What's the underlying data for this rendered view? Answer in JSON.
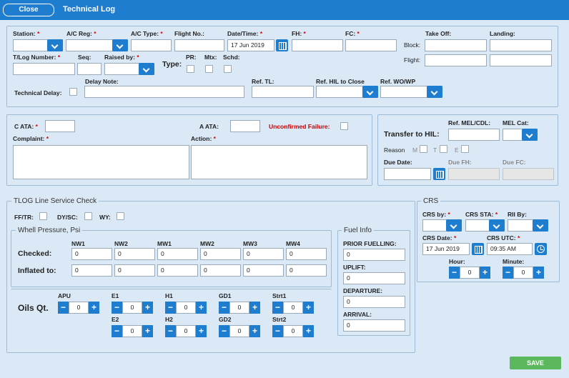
{
  "header": {
    "close_label": "Close",
    "title": "Technical Log"
  },
  "general": {
    "station_label": "Station:",
    "ac_reg_label": "A/C Reg:",
    "ac_type_label": "A/C Type:",
    "flight_no_label": "Flight No.:",
    "datetime_label": "Date/Time:",
    "datetime_value": "17 Jun 2019",
    "fh_label": "FH:",
    "fc_label": "FC:",
    "takeoff_label": "Take Off:",
    "landing_label": "Landing:",
    "block_label": "Block:",
    "flight_label": "Flight:",
    "tlog_number_label": "T/Log Number:",
    "seq_label": "Seq:",
    "raised_by_label": "Raised by:",
    "type_label": "Type:",
    "pr_label": "PR:",
    "mtx_label": "Mtx:",
    "schd_label": "Schd:",
    "technical_delay_label": "Technical Delay:",
    "delay_note_label": "Delay Note:",
    "ref_tl_label": "Ref. TL:",
    "ref_hil_label": "Ref. HIL to Close",
    "ref_wo_label": "Ref. WO/WP",
    "required_mark": "*"
  },
  "complaint": {
    "c_ata_label": "C ATA:",
    "a_ata_label": "A ATA:",
    "unconfirmed_label": "Unconfirmed Failure:",
    "complaint_label": "Complaint:",
    "action_label": "Action:"
  },
  "hil": {
    "ref_mel_label": "Ref. MEL/CDL:",
    "mel_cat_label": "MEL Cat:",
    "transfer_label": "Transfer to HIL:",
    "reason_label": "Reason",
    "reason_m": "M",
    "reason_t": "T",
    "reason_e": "E",
    "due_date_label": "Due Date:",
    "due_fh_label": "Due FH:",
    "due_fc_label": "Due FC:"
  },
  "line_check": {
    "legend": "TLOG Line Service Check",
    "fftr_label": "FF/TR:",
    "dysc_label": "DY/SC:",
    "wy_label": "WY:",
    "wheel_legend": "Whell Pressure, Psi",
    "wheel_columns": [
      "NW1",
      "NW2",
      "MW1",
      "MW2",
      "MW3",
      "MW4"
    ],
    "checked_label": "Checked:",
    "checked_values": [
      "0",
      "0",
      "0",
      "0",
      "0",
      "0"
    ],
    "inflated_label": "Inflated to:",
    "inflated_values": [
      "0",
      "0",
      "0",
      "0",
      "0",
      "0"
    ],
    "oils_label": "Oils Qt.",
    "oils_row1": [
      {
        "label": "APU",
        "value": "0"
      },
      {
        "label": "E1",
        "value": "0"
      },
      {
        "label": "H1",
        "value": "0"
      },
      {
        "label": "GD1",
        "value": "0"
      },
      {
        "label": "Strt1",
        "value": "0"
      }
    ],
    "oils_row2": [
      {
        "label": "E2",
        "value": "0"
      },
      {
        "label": "H2",
        "value": "0"
      },
      {
        "label": "GD2",
        "value": "0"
      },
      {
        "label": "Strt2",
        "value": "0"
      }
    ],
    "minus": "−",
    "plus": "+"
  },
  "fuel": {
    "legend": "Fuel Info",
    "prior_label": "PRIOR FUELLING:",
    "prior_value": "0",
    "uplift_label": "UPLIFT:",
    "uplift_value": "0",
    "departure_label": "DEPARTURE:",
    "departure_value": "0",
    "arrival_label": "ARRIVAL:",
    "arrival_value": "0"
  },
  "crs": {
    "legend": "CRS",
    "crs_by_label": "CRS by:",
    "crs_sta_label": "CRS STA:",
    "rii_by_label": "RII By:",
    "crs_date_label": "CRS Date:",
    "crs_date_value": "17 Jun 2019",
    "crs_utc_label": "CRS UTC:",
    "crs_utc_value": "09:35 AM",
    "hour_label": "Hour:",
    "hour_value": "0",
    "minute_label": "Minute:",
    "minute_value": "0"
  },
  "footer": {
    "save_label": "SAVE"
  },
  "colors": {
    "accent": "#1f7dd0",
    "background": "#dbe9f7",
    "save": "#5cb85c",
    "required": "#dd0000"
  }
}
